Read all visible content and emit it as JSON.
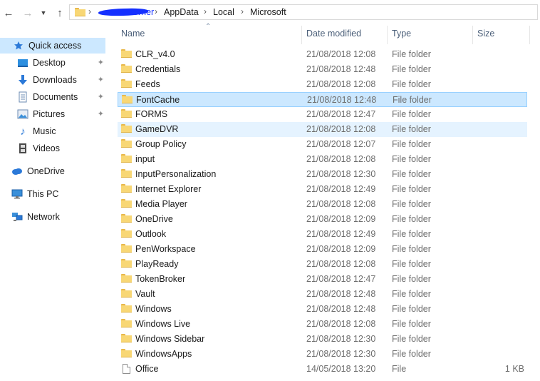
{
  "nav": {
    "back_icon": "arrow-left-icon",
    "forward_icon": "arrow-right-icon",
    "recent_icon": "chevron-down-icon",
    "up_icon": "arrow-up-icon"
  },
  "address": {
    "crumbs": [
      "Horner",
      "AppData",
      "Local",
      "Microsoft"
    ],
    "separator": "›"
  },
  "sidebar": {
    "items": [
      {
        "label": "Quick access",
        "icon": "star-icon",
        "pinned": false,
        "selected": true
      },
      {
        "label": "Desktop",
        "icon": "desktop-icon",
        "pinned": true
      },
      {
        "label": "Downloads",
        "icon": "download-icon",
        "pinned": true
      },
      {
        "label": "Documents",
        "icon": "documents-icon",
        "pinned": true
      },
      {
        "label": "Pictures",
        "icon": "pictures-icon",
        "pinned": true
      },
      {
        "label": "Music",
        "icon": "music-icon",
        "pinned": false
      },
      {
        "label": "Videos",
        "icon": "videos-icon",
        "pinned": false
      },
      {
        "label": "OneDrive",
        "icon": "onedrive-cloud-icon",
        "pinned": false
      },
      {
        "label": "This PC",
        "icon": "computer-icon",
        "pinned": false
      },
      {
        "label": "Network",
        "icon": "network-icon",
        "pinned": false
      }
    ],
    "pin_glyph": "📌"
  },
  "columns": {
    "name": "Name",
    "date": "Date modified",
    "type": "Type",
    "size": "Size",
    "sort_glyph": "⌃"
  },
  "files": [
    {
      "name": "CLR_v4.0",
      "date": "21/08/2018 12:08",
      "type": "File folder",
      "size": "",
      "kind": "folder"
    },
    {
      "name": "Credentials",
      "date": "21/08/2018 12:48",
      "type": "File folder",
      "size": "",
      "kind": "folder"
    },
    {
      "name": "Feeds",
      "date": "21/08/2018 12:08",
      "type": "File folder",
      "size": "",
      "kind": "folder"
    },
    {
      "name": "FontCache",
      "date": "21/08/2018 12:48",
      "type": "File folder",
      "size": "",
      "kind": "folder",
      "state": "selected"
    },
    {
      "name": "FORMS",
      "date": "21/08/2018 12:47",
      "type": "File folder",
      "size": "",
      "kind": "folder"
    },
    {
      "name": "GameDVR",
      "date": "21/08/2018 12:08",
      "type": "File folder",
      "size": "",
      "kind": "folder",
      "state": "hover"
    },
    {
      "name": "Group Policy",
      "date": "21/08/2018 12:07",
      "type": "File folder",
      "size": "",
      "kind": "folder"
    },
    {
      "name": "input",
      "date": "21/08/2018 12:08",
      "type": "File folder",
      "size": "",
      "kind": "folder"
    },
    {
      "name": "InputPersonalization",
      "date": "21/08/2018 12:30",
      "type": "File folder",
      "size": "",
      "kind": "folder"
    },
    {
      "name": "Internet Explorer",
      "date": "21/08/2018 12:49",
      "type": "File folder",
      "size": "",
      "kind": "folder"
    },
    {
      "name": "Media Player",
      "date": "21/08/2018 12:08",
      "type": "File folder",
      "size": "",
      "kind": "folder"
    },
    {
      "name": "OneDrive",
      "date": "21/08/2018 12:09",
      "type": "File folder",
      "size": "",
      "kind": "folder"
    },
    {
      "name": "Outlook",
      "date": "21/08/2018 12:49",
      "type": "File folder",
      "size": "",
      "kind": "folder"
    },
    {
      "name": "PenWorkspace",
      "date": "21/08/2018 12:09",
      "type": "File folder",
      "size": "",
      "kind": "folder"
    },
    {
      "name": "PlayReady",
      "date": "21/08/2018 12:08",
      "type": "File folder",
      "size": "",
      "kind": "folder"
    },
    {
      "name": "TokenBroker",
      "date": "21/08/2018 12:47",
      "type": "File folder",
      "size": "",
      "kind": "folder"
    },
    {
      "name": "Vault",
      "date": "21/08/2018 12:48",
      "type": "File folder",
      "size": "",
      "kind": "folder"
    },
    {
      "name": "Windows",
      "date": "21/08/2018 12:48",
      "type": "File folder",
      "size": "",
      "kind": "folder"
    },
    {
      "name": "Windows Live",
      "date": "21/08/2018 12:08",
      "type": "File folder",
      "size": "",
      "kind": "folder"
    },
    {
      "name": "Windows Sidebar",
      "date": "21/08/2018 12:30",
      "type": "File folder",
      "size": "",
      "kind": "folder"
    },
    {
      "name": "WindowsApps",
      "date": "21/08/2018 12:30",
      "type": "File folder",
      "size": "",
      "kind": "folder"
    },
    {
      "name": "Office",
      "date": "14/05/2018 13:20",
      "type": "File",
      "size": "1 KB",
      "kind": "file"
    }
  ],
  "colors": {
    "selection": "#cce8ff",
    "selection_border": "#99d1ff",
    "hover": "#e5f3ff",
    "redaction": "#1530ff"
  }
}
